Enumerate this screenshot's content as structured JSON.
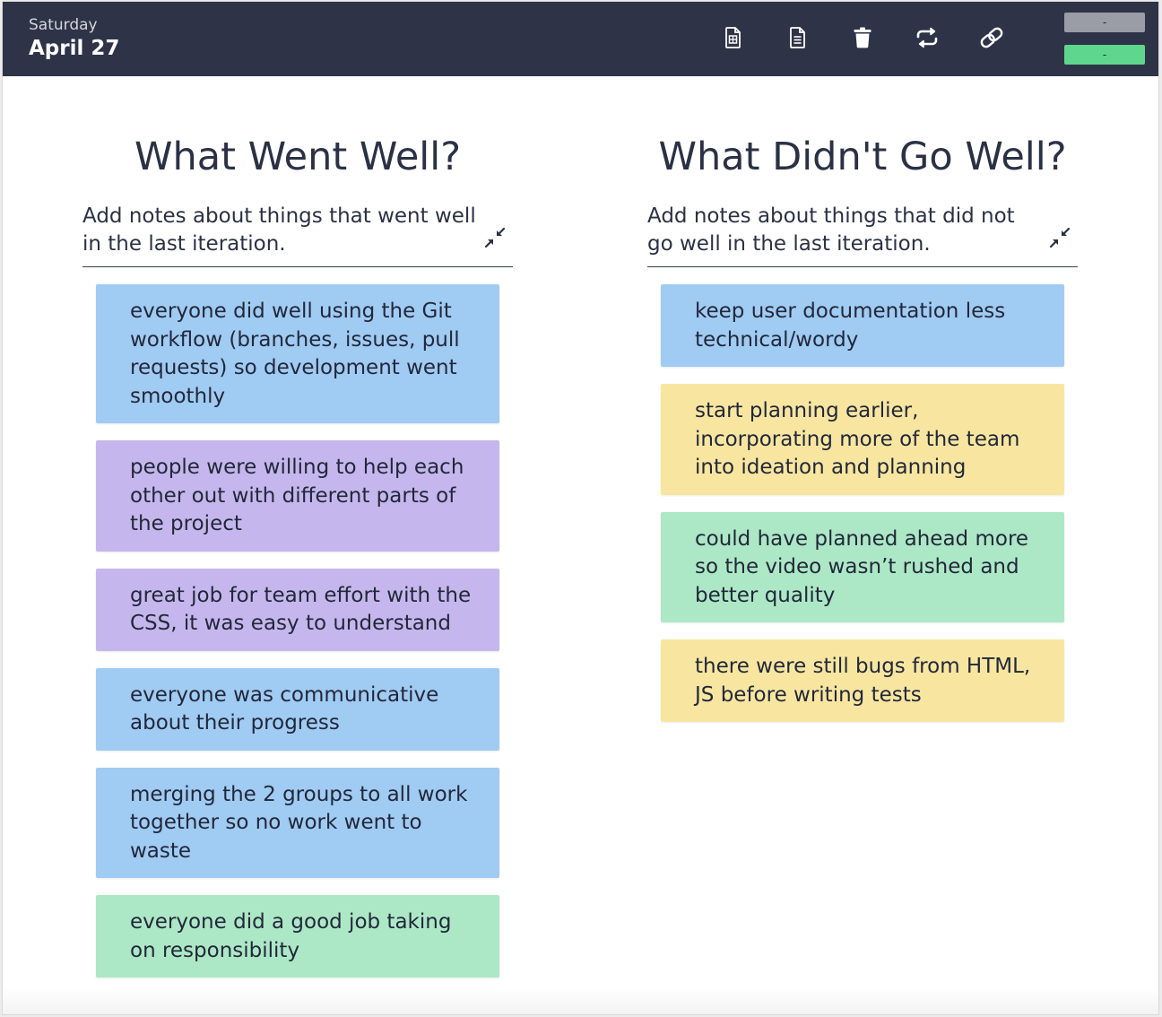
{
  "header": {
    "weekday": "Saturday",
    "date": "April 27",
    "toolbar": {
      "icons": [
        "spreadsheet-icon",
        "document-icon",
        "trash-icon",
        "repeat-icon",
        "link-icon"
      ]
    },
    "pill_top": {
      "label": "-",
      "color": "#9a9ca6"
    },
    "pill_bottom": {
      "label": "-",
      "color": "#5fd68d"
    }
  },
  "colors": {
    "blue": "#a0cbf3",
    "purple": "#c5b7ed",
    "green": "#ade8c6",
    "yellow": "#f8e6a0",
    "topbar": "#2e3347"
  },
  "columns": [
    {
      "title": "What Went Well?",
      "subtitle": "Add notes about things that went well in the last iteration.",
      "notes": [
        {
          "text": "everyone did well using the Git workflow (branches, issues, pull requests) so development went smoothly",
          "color": "blue"
        },
        {
          "text": "people were willing to help each other out with different parts of the project",
          "color": "purple"
        },
        {
          "text": "great job for team effort with the CSS, it was easy to understand",
          "color": "purple"
        },
        {
          "text": "everyone was communicative about their progress",
          "color": "blue"
        },
        {
          "text": "merging the 2 groups to all work together so no work went to waste",
          "color": "blue"
        },
        {
          "text": "everyone did a good job taking on responsibility",
          "color": "green"
        }
      ]
    },
    {
      "title": "What Didn't Go Well?",
      "subtitle": "Add notes about things that did not go well in the last iteration.",
      "notes": [
        {
          "text": "keep user documentation less technical/wordy",
          "color": "blue"
        },
        {
          "text": "start planning earlier, incorporating more of the team into ideation and planning",
          "color": "yellow"
        },
        {
          "text": "could have planned ahead more so the video wasn’t rushed and better quality",
          "color": "green"
        },
        {
          "text": "there were still bugs from HTML, JS before writing tests",
          "color": "yellow"
        }
      ]
    }
  ]
}
